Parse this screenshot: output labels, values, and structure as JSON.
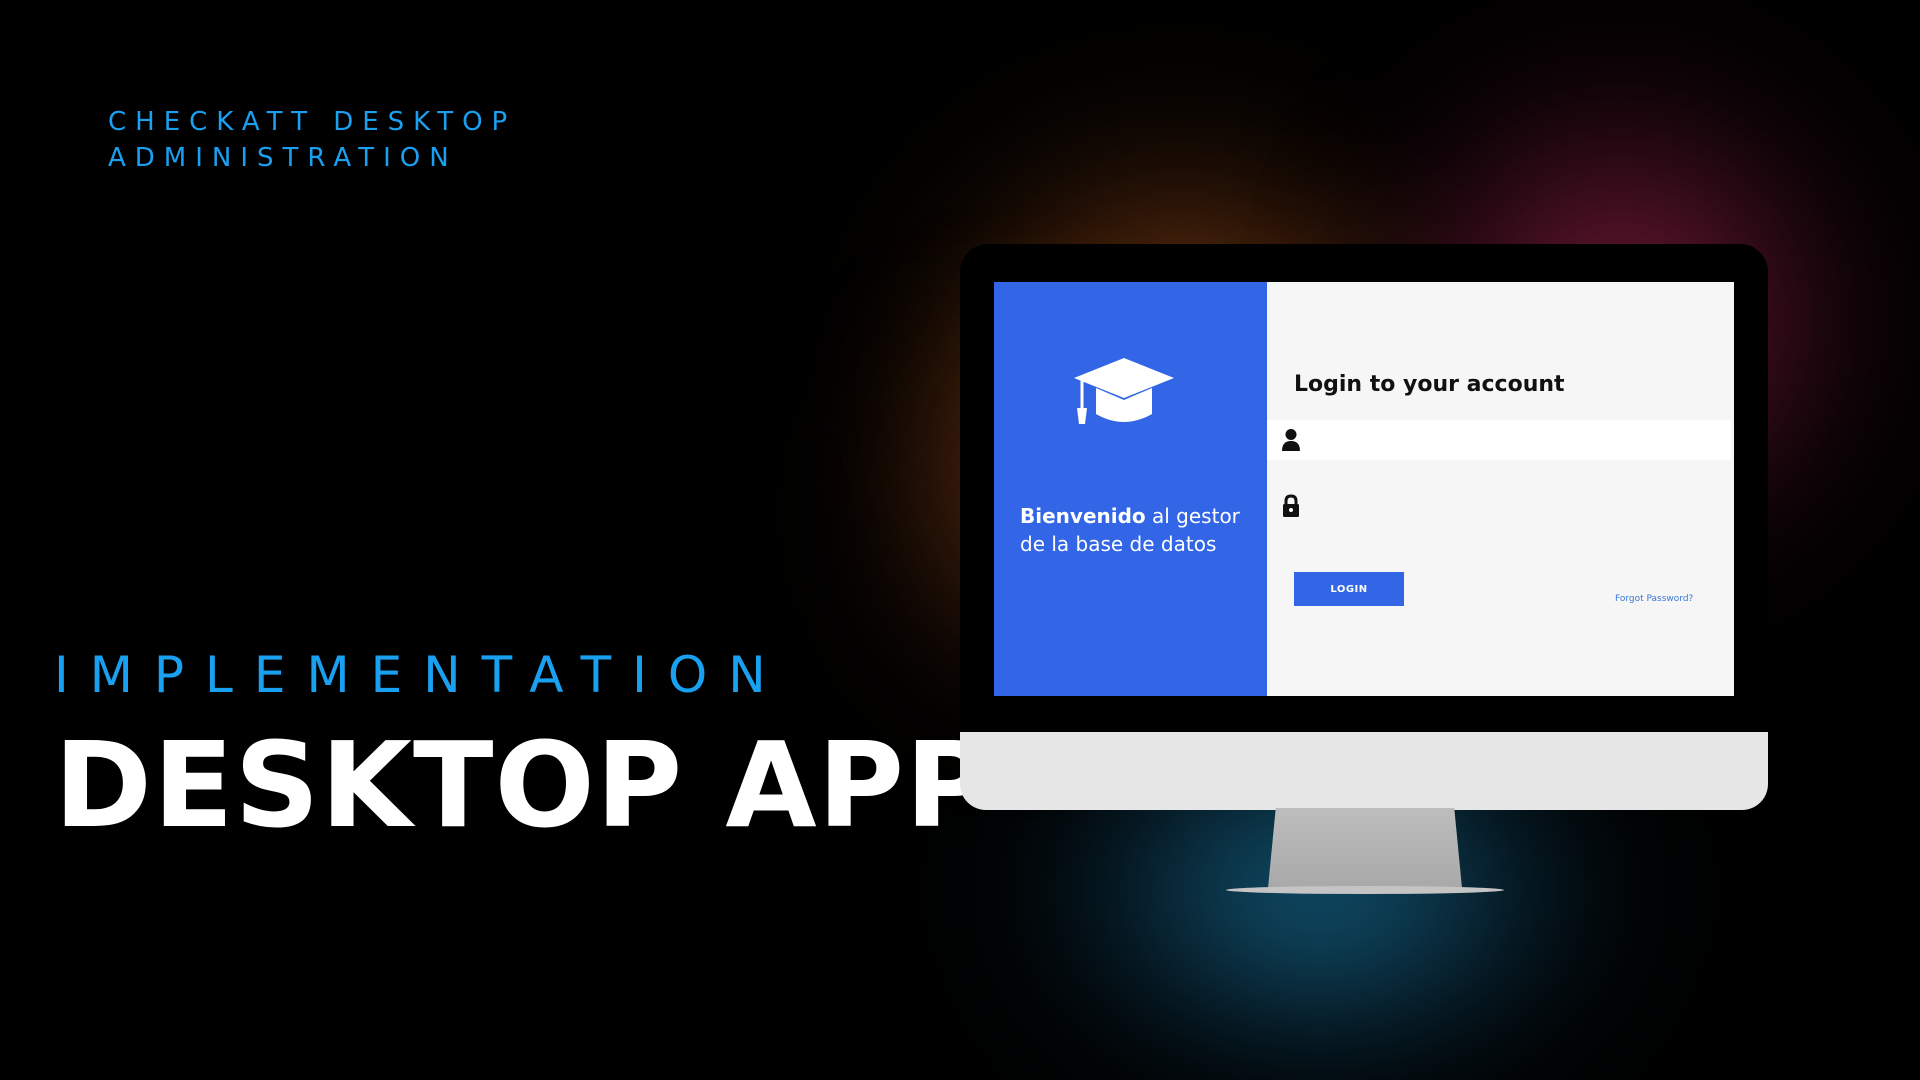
{
  "slide": {
    "kicker_line1": "CHECKATT DESKTOP",
    "kicker_line2": "ADMINISTRATION",
    "section_label": "IMPLEMENTATION",
    "headline": "DESKTOP APP"
  },
  "app": {
    "welcome_bold": "Bienvenido",
    "welcome_rest": " al gestor de la base de datos",
    "login_title": "Login to your account",
    "username_placeholder": "",
    "password_placeholder": "",
    "login_button": "LOGIN",
    "forgot_link": "Forgot Password?"
  },
  "icons": {
    "logo": "graduation-cap-icon",
    "username": "user-icon",
    "password": "lock-icon"
  },
  "colors": {
    "background": "#000000",
    "accent_text": "#1aa0f0",
    "brand_blue": "#3366e6",
    "screen_bg": "#f6f6f6",
    "link": "#3a78d8"
  }
}
